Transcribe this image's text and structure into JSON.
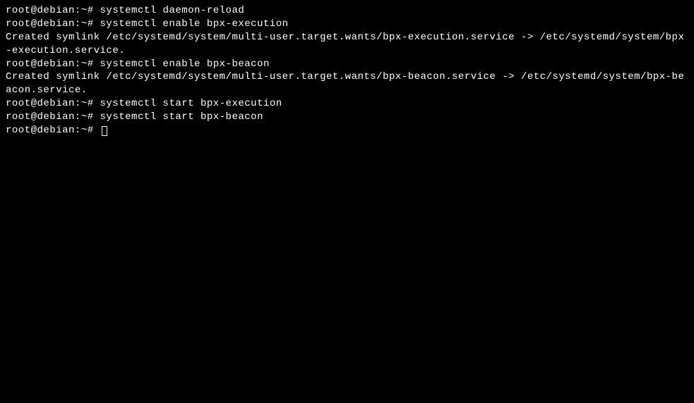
{
  "terminal": {
    "prompt": "root@debian:~# ",
    "lines": [
      {
        "type": "cmd",
        "command": "systemctl daemon-reload"
      },
      {
        "type": "cmd",
        "command": "systemctl enable bpx-execution"
      },
      {
        "type": "output",
        "text": "Created symlink /etc/systemd/system/multi-user.target.wants/bpx-execution.service -> /etc/systemd/system/bpx-execution.service."
      },
      {
        "type": "cmd",
        "command": "systemctl enable bpx-beacon"
      },
      {
        "type": "output",
        "text": "Created symlink /etc/systemd/system/multi-user.target.wants/bpx-beacon.service -> /etc/systemd/system/bpx-beacon.service."
      },
      {
        "type": "cmd",
        "command": "systemctl start bpx-execution"
      },
      {
        "type": "cmd",
        "command": "systemctl start bpx-beacon"
      },
      {
        "type": "prompt_only"
      }
    ]
  }
}
